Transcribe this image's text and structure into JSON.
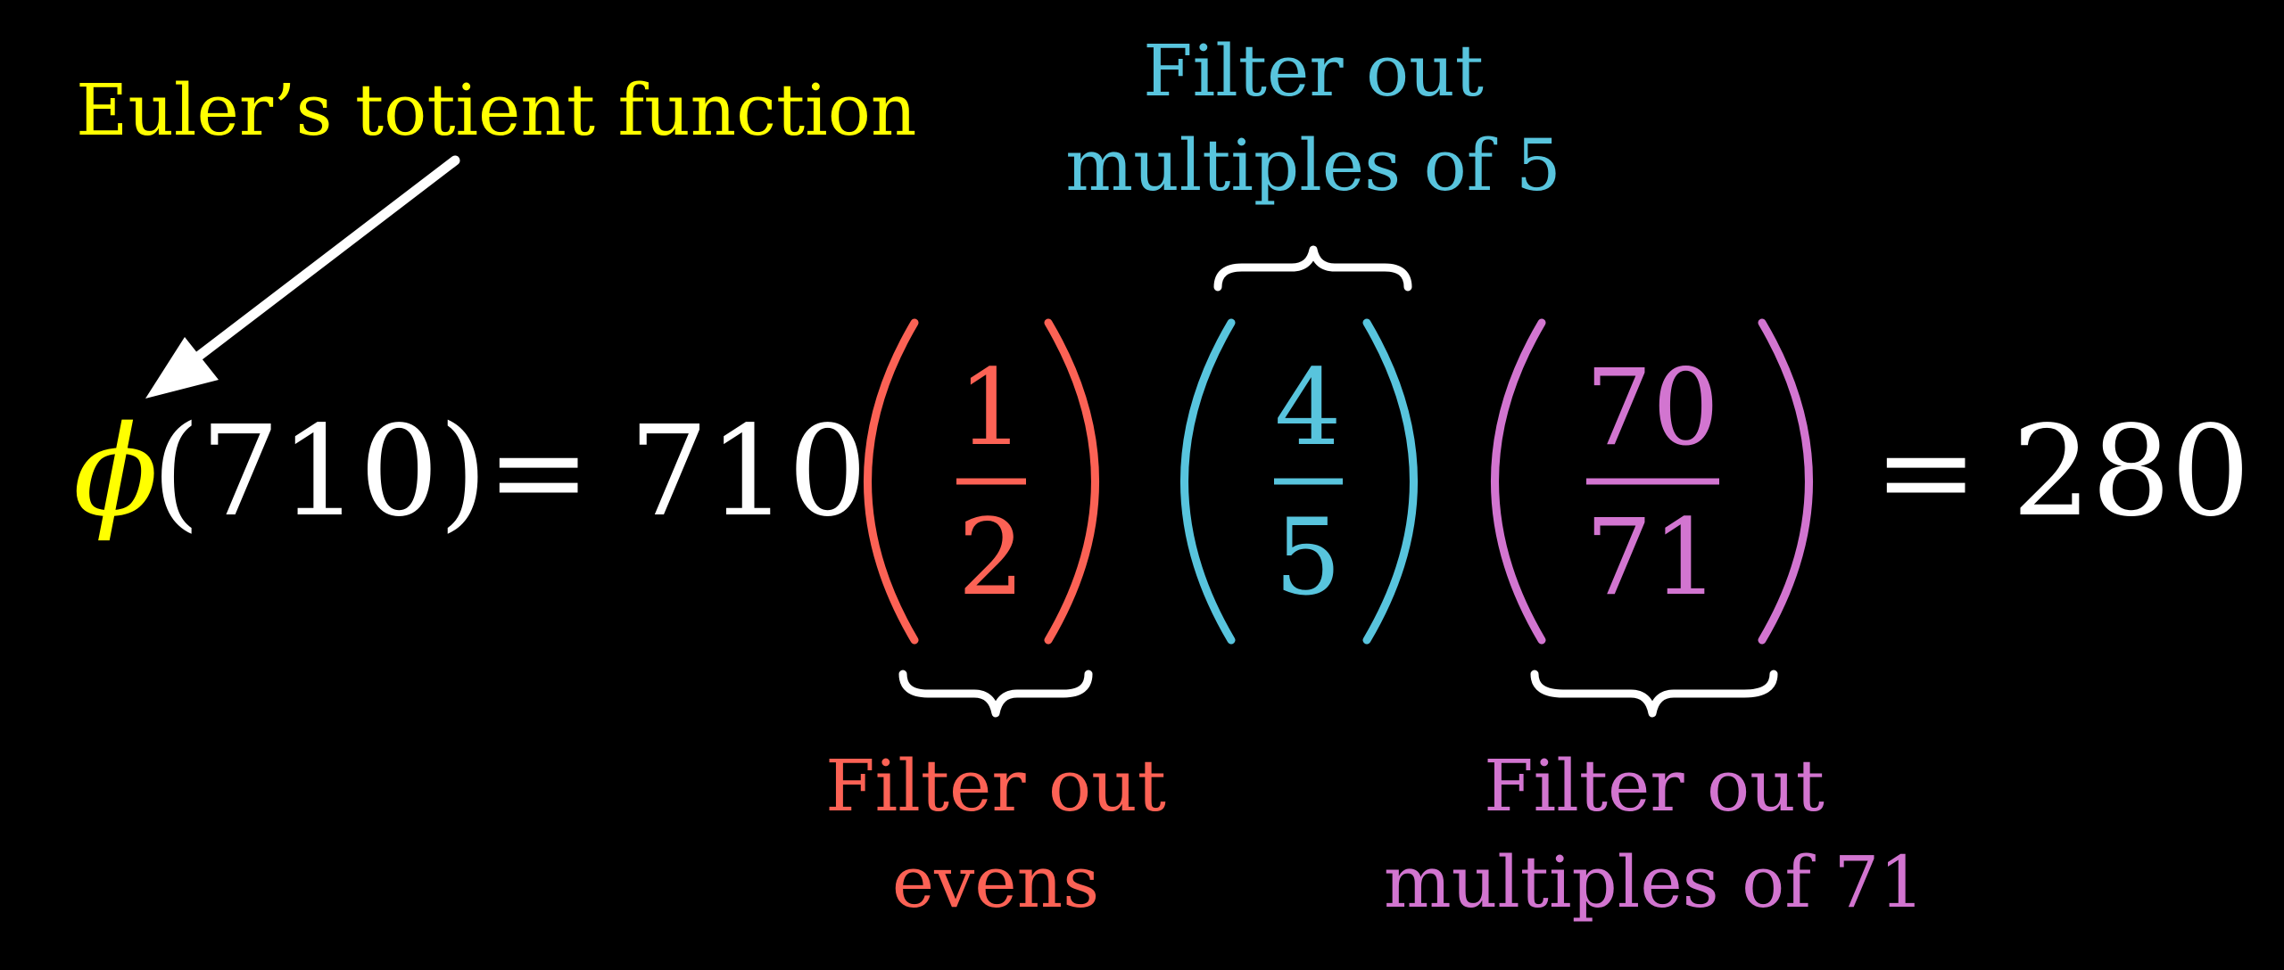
{
  "colors": {
    "yellow": "#ffff00",
    "white": "#ffffff",
    "red": "#fc6255",
    "blue": "#58c4dd",
    "pink": "#d275d0",
    "background": "#000000"
  },
  "annotations": {
    "totient": "Euler’s totient function",
    "five_line1": "Filter out",
    "five_line2": "multiples of 5",
    "evens_line1": "Filter out",
    "evens_line2": "evens",
    "seventyone_line1": "Filter out",
    "seventyone_line2": "multiples of 71"
  },
  "equation": {
    "phi_symbol": "ϕ",
    "lhs_argument": "(710)",
    "equals": "=",
    "coefficient": "710",
    "fractions": [
      {
        "numerator": "1",
        "denominator": "2",
        "color": "red"
      },
      {
        "numerator": "4",
        "denominator": "5",
        "color": "blue"
      },
      {
        "numerator": "70",
        "denominator": "71",
        "color": "pink"
      }
    ],
    "result": "280"
  },
  "icons": [
    "arrow-icon",
    "brace-icon"
  ]
}
